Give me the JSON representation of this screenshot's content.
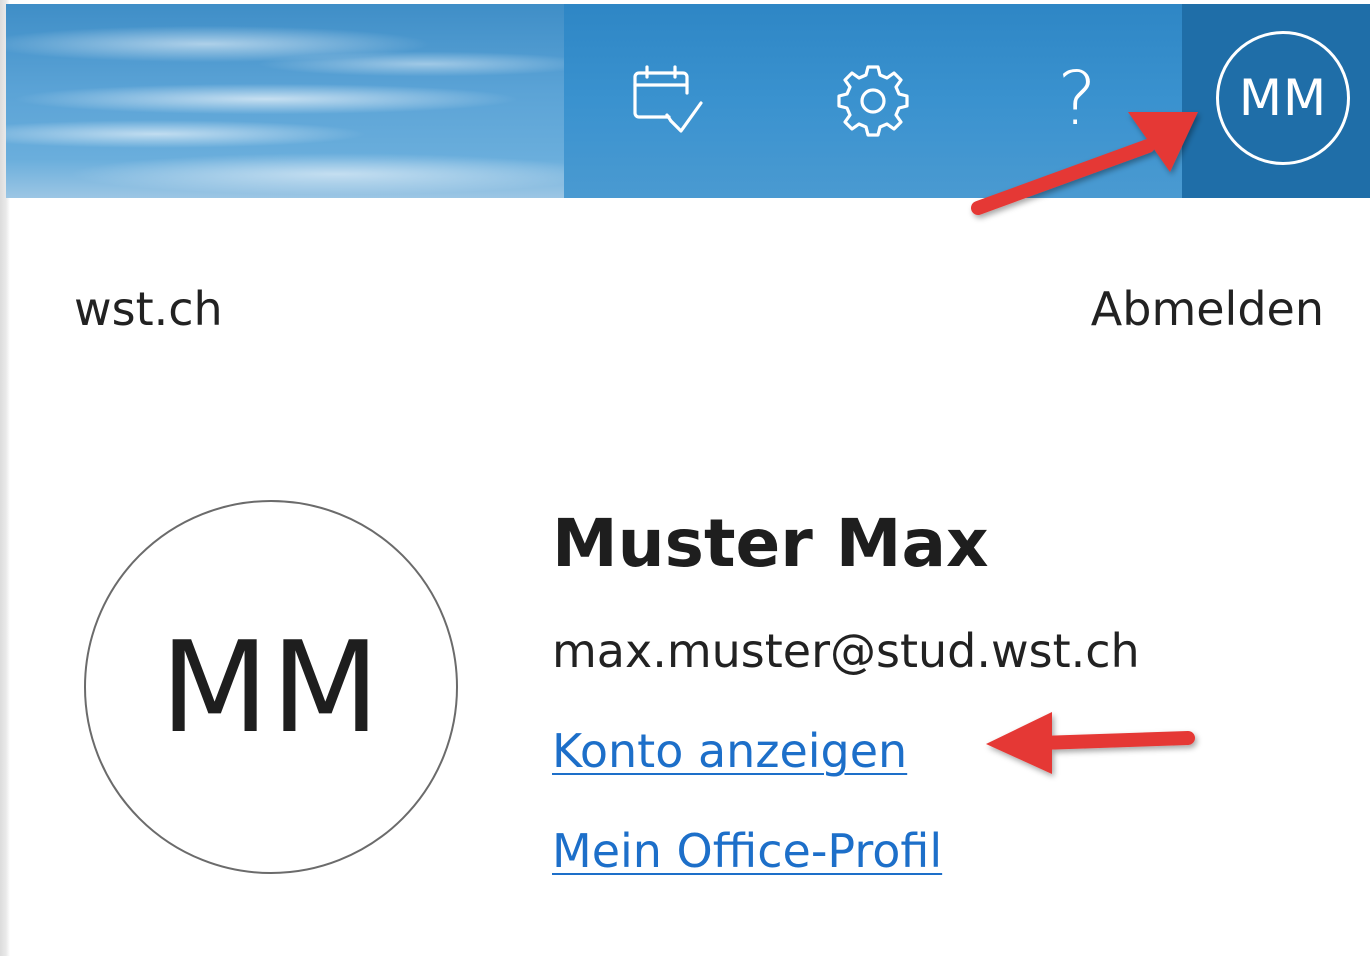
{
  "header": {
    "icons": {
      "calendar": "calendar-check-icon",
      "settings": "gear-icon",
      "help": "help-icon"
    },
    "help_glyph": "?",
    "account_initials": "MM",
    "colors": {
      "toolbar": "#3a92cf",
      "account_active": "#1f6ea8"
    }
  },
  "account_panel": {
    "organization": "wst.ch",
    "sign_out_label": "Abmelden",
    "avatar_initials": "MM",
    "display_name": "Muster Max",
    "email": "max.muster@stud.wst.ch",
    "view_account_link": "Konto anzeigen",
    "office_profile_link": "Mein Office-Profil",
    "link_color": "#1d6fc9"
  },
  "annotations": {
    "arrow_color": "#e53935"
  }
}
